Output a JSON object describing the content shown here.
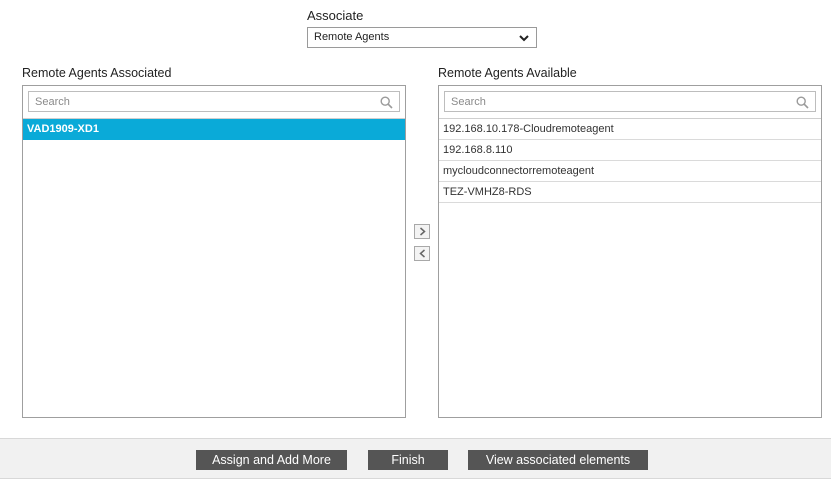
{
  "associate": {
    "label": "Associate",
    "selected": "Remote Agents",
    "icon": "chevron-down-icon"
  },
  "left_panel": {
    "title": "Remote Agents Associated",
    "search_placeholder": "Search",
    "items": [
      {
        "label": "VAD1909-XD1",
        "selected": true
      }
    ]
  },
  "right_panel": {
    "title": "Remote Agents Available",
    "search_placeholder": "Search",
    "items": [
      {
        "label": "192.168.10.178-Cloudremoteagent"
      },
      {
        "label": "192.168.8.110"
      },
      {
        "label": "mycloudconnectorremoteagent"
      },
      {
        "label": "TEZ-VMHZ8-RDS"
      }
    ]
  },
  "transfer": {
    "move_right_icon": "chevron-right-icon",
    "move_left_icon": "chevron-left-icon"
  },
  "footer": {
    "assign_label": "Assign and Add More",
    "finish_label": "Finish",
    "view_label": "View associated elements"
  },
  "colors": {
    "selection": "#0aaad8",
    "button": "#555555",
    "footer_bg": "#f1f1f1"
  }
}
